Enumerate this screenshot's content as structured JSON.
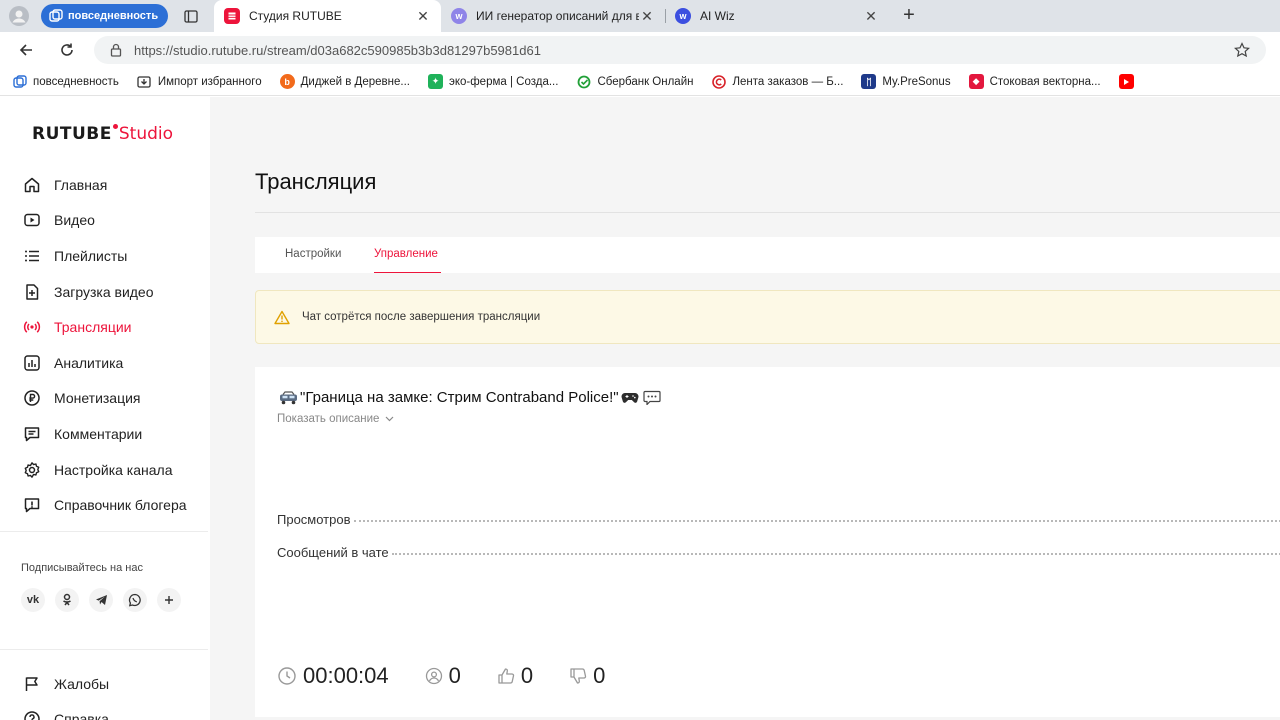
{
  "browser": {
    "workspace_label": "повседневность",
    "tabs": [
      {
        "title": "Студия RUTUBE",
        "active": true
      },
      {
        "title": "ИИ генератор описаний для вид",
        "active": false
      },
      {
        "title": "AI Wiz",
        "active": false
      }
    ],
    "url": "https://studio.rutube.ru/stream/d03a682c590985b3b3d81297b5981d61",
    "bookmarks": [
      {
        "label": "повседневность",
        "icon": "workspace-icon"
      },
      {
        "label": "Импорт избранного",
        "icon": "import-icon"
      },
      {
        "label": "Диджей в Деревне...",
        "icon": "b-icon"
      },
      {
        "label": "эко-ферма | Созда...",
        "icon": "eco-icon"
      },
      {
        "label": "Сбербанк Онлайн",
        "icon": "sber-icon"
      },
      {
        "label": "Лента заказов — Б...",
        "icon": "c-icon"
      },
      {
        "label": "My.PreSonus",
        "icon": "presonus-icon"
      },
      {
        "label": "Стоковая векторна...",
        "icon": "stock-icon"
      },
      {
        "label": "",
        "icon": "youtube-icon"
      }
    ]
  },
  "sidebar": {
    "logo_main": "RUTUBE",
    "logo_studio": "Studio",
    "items": [
      {
        "label": "Главная",
        "icon": "home-icon"
      },
      {
        "label": "Видео",
        "icon": "video-icon"
      },
      {
        "label": "Плейлисты",
        "icon": "playlist-icon"
      },
      {
        "label": "Загрузка видео",
        "icon": "upload-icon"
      },
      {
        "label": "Трансляции",
        "icon": "broadcast-icon",
        "active": true
      },
      {
        "label": "Аналитика",
        "icon": "analytics-icon"
      },
      {
        "label": "Монетизация",
        "icon": "ruble-icon"
      },
      {
        "label": "Комментарии",
        "icon": "comments-icon"
      },
      {
        "label": "Настройка канала",
        "icon": "gear-icon"
      },
      {
        "label": "Справочник блогера",
        "icon": "info-icon"
      }
    ],
    "follow_label": "Подписывайтесь на нас",
    "socials": [
      "vk-icon",
      "ok-icon",
      "telegram-icon",
      "viber-icon",
      "more-icon"
    ],
    "bottom_items": [
      {
        "label": "Жалобы",
        "icon": "flag-icon"
      },
      {
        "label": "Справка",
        "icon": "help-icon"
      }
    ]
  },
  "main": {
    "title": "Трансляция",
    "tabs": [
      {
        "label": "Настройки",
        "active": false
      },
      {
        "label": "Управление",
        "active": true
      }
    ],
    "alert_text": "Чат сотрётся после завершения трансляции",
    "stream": {
      "title": "\"Граница на замке: Стрим Contraband Police!\"",
      "show_description": "Показать описание",
      "stats": [
        {
          "label": "Просмотров"
        },
        {
          "label": "Сообщений в чате"
        }
      ],
      "duration": "00:00:04",
      "viewers": "0",
      "likes": "0",
      "dislikes": "0"
    }
  },
  "colors": {
    "accent": "#ed143b",
    "workspace_blue": "#2c6fd6",
    "alert_bg": "#fdf9e6"
  }
}
